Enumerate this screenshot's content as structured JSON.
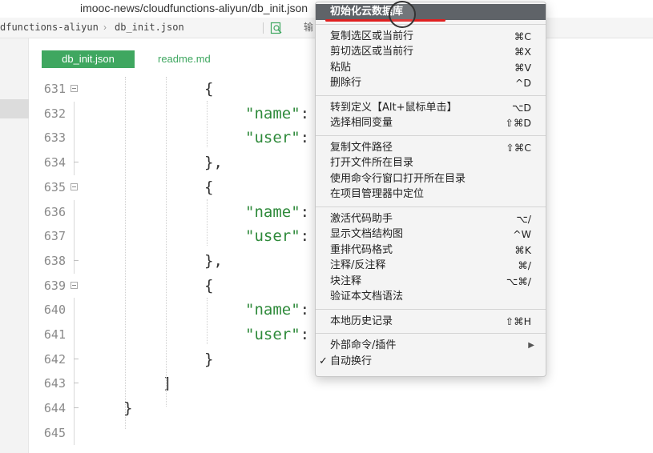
{
  "window": {
    "title": "imooc-news/cloudfunctions-aliyun/db_init.json"
  },
  "breadcrumb": {
    "folder": "dfunctions-aliyun",
    "file": "db_init.json",
    "sep": "›",
    "tool_label": "输"
  },
  "tabs": [
    {
      "label": "db_init.json",
      "active": true
    },
    {
      "label": "readme.md",
      "active": false
    }
  ],
  "editor": {
    "lines": [
      {
        "num": "631",
        "fold": true,
        "code": "{",
        "indent": "l3"
      },
      {
        "num": "632",
        "fold": false,
        "code_key": "\"name\"",
        "code_rest": ":",
        "indent": "l4"
      },
      {
        "num": "633",
        "fold": false,
        "code_key": "\"user\"",
        "code_rest": ":",
        "indent": "l4"
      },
      {
        "num": "634",
        "fold": false,
        "code": "},",
        "indent": "l3",
        "end": true
      },
      {
        "num": "635",
        "fold": true,
        "code": "{",
        "indent": "l3"
      },
      {
        "num": "636",
        "fold": false,
        "code_key": "\"name\"",
        "code_rest": ":",
        "indent": "l4"
      },
      {
        "num": "637",
        "fold": false,
        "code_key": "\"user\"",
        "code_rest": ":",
        "indent": "l4"
      },
      {
        "num": "638",
        "fold": false,
        "code": "},",
        "indent": "l3",
        "end": true
      },
      {
        "num": "639",
        "fold": true,
        "code": "{",
        "indent": "l3"
      },
      {
        "num": "640",
        "fold": false,
        "code_key": "\"name\"",
        "code_rest": ":",
        "indent": "l4"
      },
      {
        "num": "641",
        "fold": false,
        "code_key": "\"user\"",
        "code_rest": ":",
        "indent": "l4"
      },
      {
        "num": "642",
        "fold": false,
        "code": "}",
        "indent": "l3",
        "end": true
      },
      {
        "num": "643",
        "fold": false,
        "code": "]",
        "indent": "l2",
        "end": true
      },
      {
        "num": "644",
        "fold": false,
        "code": "}",
        "indent": "l1",
        "end": true
      },
      {
        "num": "645",
        "fold": false,
        "code": "",
        "indent": "l1"
      }
    ]
  },
  "context_menu": {
    "groups": [
      [
        {
          "label": "初始化云数据库",
          "shortcut": "",
          "selected": true
        }
      ],
      [
        {
          "label": "复制选区或当前行",
          "shortcut": "⌘C"
        },
        {
          "label": "剪切选区或当前行",
          "shortcut": "⌘X"
        },
        {
          "label": "粘贴",
          "shortcut": "⌘V"
        },
        {
          "label": "删除行",
          "shortcut": "^D"
        }
      ],
      [
        {
          "label": "转到定义【Alt+鼠标单击】",
          "shortcut": "⌥D"
        },
        {
          "label": "选择相同变量",
          "shortcut": "⇧⌘D"
        }
      ],
      [
        {
          "label": "复制文件路径",
          "shortcut": "⇧⌘C"
        },
        {
          "label": "打开文件所在目录",
          "shortcut": ""
        },
        {
          "label": "使用命令行窗口打开所在目录",
          "shortcut": ""
        },
        {
          "label": "在项目管理器中定位",
          "shortcut": ""
        }
      ],
      [
        {
          "label": "激活代码助手",
          "shortcut": "⌥/"
        },
        {
          "label": "显示文档结构图",
          "shortcut": "^W"
        },
        {
          "label": "重排代码格式",
          "shortcut": "⌘K"
        },
        {
          "label": "注释/反注释",
          "shortcut": "⌘/"
        },
        {
          "label": "块注释",
          "shortcut": "⌥⌘/"
        },
        {
          "label": "验证本文档语法",
          "shortcut": ""
        }
      ],
      [
        {
          "label": "本地历史记录",
          "shortcut": "⇧⌘H"
        }
      ],
      [
        {
          "label": "外部命令/插件",
          "shortcut": "",
          "submenu": true
        },
        {
          "label": "自动换行",
          "shortcut": "",
          "checked": true
        }
      ]
    ],
    "check_glyph": "✓",
    "submenu_glyph": "▶"
  },
  "colors": {
    "accent": "#3fa760",
    "menu_selected": "#5f6368",
    "annotation": "#e02020"
  }
}
